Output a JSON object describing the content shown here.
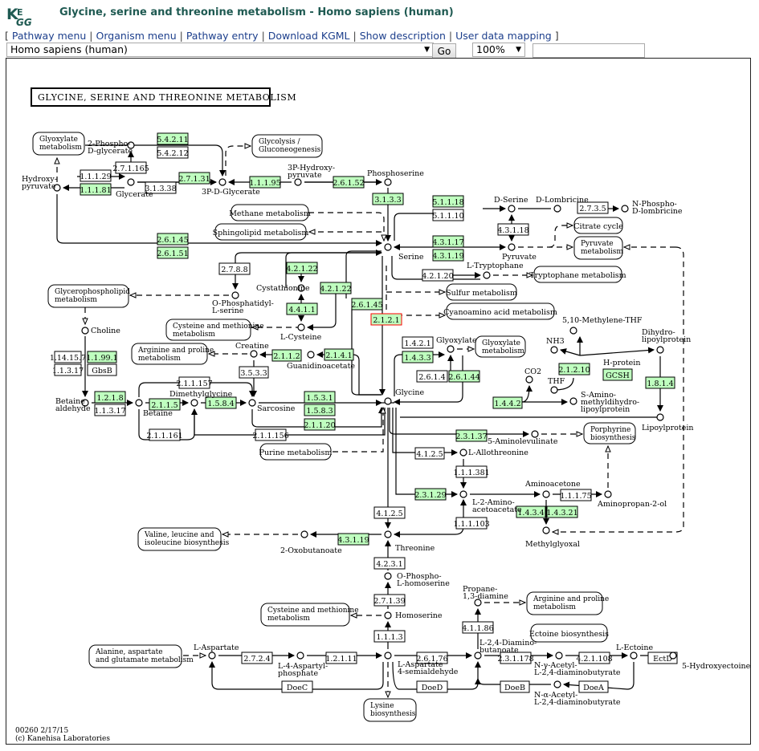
{
  "header": {
    "logo_text": "KEGG",
    "title": "Glycine, serine and threonine metabolism - Homo sapiens (human)"
  },
  "nav": {
    "open": "[",
    "close": "]",
    "sep": "|",
    "links": [
      "Pathway menu",
      "Organism menu",
      "Pathway entry",
      "Download KGML",
      "Show description",
      "User data mapping"
    ]
  },
  "controls": {
    "organism_selected": "Homo sapiens (human)",
    "go_label": "Go",
    "zoom_selected": "100%",
    "search_value": ""
  },
  "colors": {
    "link": "#1d3f8c",
    "title": "#1f5a52",
    "enzyme_present": "#bfffbf",
    "enzyme_highlight_border": "#ff0000"
  },
  "map": {
    "title": "GLYCINE, SERINE AND THREONINE METABOLISM",
    "footer_line1": "00260 2/17/15",
    "footer_line2": "(c) Kanehisa Laboratories",
    "pathways": [
      {
        "id": "p_glyox1",
        "lines": [
          "Glyoxylate",
          "metabolism"
        ]
      },
      {
        "id": "p_glycolysis",
        "lines": [
          "Glycolysis /",
          "Gluconeogenesis"
        ]
      },
      {
        "id": "p_methane",
        "lines": [
          "Methane metabolism"
        ]
      },
      {
        "id": "p_sphingo",
        "lines": [
          "Sphingolipid metabolism"
        ]
      },
      {
        "id": "p_citrate",
        "lines": [
          "Citrate cycle"
        ]
      },
      {
        "id": "p_pyruvate",
        "lines": [
          "Pyruvate",
          "metabolism"
        ]
      },
      {
        "id": "p_trp",
        "lines": [
          "Tryptophane metabolism"
        ]
      },
      {
        "id": "p_sulfur",
        "lines": [
          "Sulfur metabolism"
        ]
      },
      {
        "id": "p_cyano",
        "lines": [
          "Cyanoamino acid metabolism"
        ]
      },
      {
        "id": "p_glycerophos",
        "lines": [
          "Glycerophospholipid",
          "metabolism"
        ]
      },
      {
        "id": "p_cysmet1",
        "lines": [
          "Cysteine and methionine",
          "metabolism"
        ]
      },
      {
        "id": "p_argpro1",
        "lines": [
          "Arginine and proline",
          "metabolism"
        ]
      },
      {
        "id": "p_glyox2",
        "lines": [
          "Glyoxylate",
          "metabolism"
        ]
      },
      {
        "id": "p_purine",
        "lines": [
          "Purine metabolism"
        ]
      },
      {
        "id": "p_porph",
        "lines": [
          "Porphyrine",
          "biosynthesis"
        ]
      },
      {
        "id": "p_valleu",
        "lines": [
          "Valine, leucine and",
          "isoleucine biosynthesis"
        ]
      },
      {
        "id": "p_cysmet2",
        "lines": [
          "Cysteine and methionine",
          "metabolism"
        ]
      },
      {
        "id": "p_argpro2",
        "lines": [
          "Arginine and proline",
          "metabolism"
        ]
      },
      {
        "id": "p_ectoine",
        "lines": [
          "Ectoine biosynthesis"
        ]
      },
      {
        "id": "p_alaasp",
        "lines": [
          "Alanine, aspartate",
          "and glutamate metabolism"
        ]
      },
      {
        "id": "p_lysine",
        "lines": [
          "Lysine",
          "biosynthesis"
        ]
      }
    ],
    "enzymes": [
      {
        "id": "e1",
        "label": "5.4.2.11",
        "present": true
      },
      {
        "id": "e2",
        "label": "5.4.2.12",
        "present": false
      },
      {
        "id": "e3",
        "label": "2.7.1.165",
        "present": false
      },
      {
        "id": "e4",
        "label": "1.1.1.29",
        "present": false
      },
      {
        "id": "e5",
        "label": "1.1.1.81",
        "present": true
      },
      {
        "id": "e6",
        "label": "2.7.1.31",
        "present": true
      },
      {
        "id": "e7",
        "label": "3.1.3.38",
        "present": false
      },
      {
        "id": "e8",
        "label": "1.1.1.95",
        "present": true
      },
      {
        "id": "e9",
        "label": "2.6.1.52",
        "present": true
      },
      {
        "id": "e10",
        "label": "3.1.3.3",
        "present": true
      },
      {
        "id": "e11",
        "label": "5.1.1.18",
        "present": true
      },
      {
        "id": "e12",
        "label": "5.1.1.10",
        "present": false
      },
      {
        "id": "e13",
        "label": "2.7.3.5",
        "present": false
      },
      {
        "id": "e14",
        "label": "4.3.1.18",
        "present": false
      },
      {
        "id": "e15",
        "label": "2.6.1.45",
        "present": true
      },
      {
        "id": "e16",
        "label": "2.6.1.51",
        "present": true
      },
      {
        "id": "e17",
        "label": "4.3.1.17",
        "present": true
      },
      {
        "id": "e18",
        "label": "4.3.1.19",
        "present": true
      },
      {
        "id": "e19",
        "label": "2.7.8.8",
        "present": false
      },
      {
        "id": "e20",
        "label": "4.2.1.22",
        "present": true
      },
      {
        "id": "e21",
        "label": "4.2.1.22",
        "present": true
      },
      {
        "id": "e22",
        "label": "4.4.1.1",
        "present": true
      },
      {
        "id": "e23",
        "label": "4.2.1.20",
        "present": false
      },
      {
        "id": "e24",
        "label": "2.6.1.45",
        "present": true
      },
      {
        "id": "e25",
        "label": "2.1.2.1",
        "present": true,
        "highlight": true
      },
      {
        "id": "e26",
        "label": "1.14.15.7",
        "present": false
      },
      {
        "id": "e27",
        "label": "1.1.99.1",
        "present": true
      },
      {
        "id": "e28",
        "label": "1.1.3.17",
        "present": false
      },
      {
        "id": "e29",
        "label": "GbsB",
        "present": false
      },
      {
        "id": "e30",
        "label": "2.1.1.2",
        "present": true
      },
      {
        "id": "e31",
        "label": "2.1.4.1",
        "present": true
      },
      {
        "id": "e32",
        "label": "3.5.3.3",
        "present": false
      },
      {
        "id": "e33",
        "label": "1.4.2.1",
        "present": false
      },
      {
        "id": "e34",
        "label": "1.4.3.3",
        "present": true
      },
      {
        "id": "e35",
        "label": "2.6.1.4",
        "present": false
      },
      {
        "id": "e36",
        "label": "2.6.1.44",
        "present": true
      },
      {
        "id": "e37",
        "label": "2.1.2.10",
        "present": true
      },
      {
        "id": "e38",
        "label": "GCSH",
        "present": true
      },
      {
        "id": "e39",
        "label": "1.8.1.4",
        "present": true
      },
      {
        "id": "e40",
        "label": "1.4.4.2",
        "present": true
      },
      {
        "id": "e41",
        "label": "2.1.1.157",
        "present": false
      },
      {
        "id": "e42",
        "label": "1.2.1.8",
        "present": true
      },
      {
        "id": "e43",
        "label": "1.1.3.17",
        "present": false
      },
      {
        "id": "e44",
        "label": "2.1.1.5",
        "present": true
      },
      {
        "id": "e45",
        "label": "1.5.8.4",
        "present": true
      },
      {
        "id": "e46",
        "label": "1.5.3.1",
        "present": true
      },
      {
        "id": "e47",
        "label": "1.5.8.3",
        "present": true
      },
      {
        "id": "e48",
        "label": "2.1.1.20",
        "present": true
      },
      {
        "id": "e49",
        "label": "2.1.1.161",
        "present": false
      },
      {
        "id": "e50",
        "label": "2.1.1.156",
        "present": false
      },
      {
        "id": "e51",
        "label": "2.3.1.37",
        "present": true
      },
      {
        "id": "e52",
        "label": "4.1.2.5",
        "present": false
      },
      {
        "id": "e53",
        "label": "1.1.1.381",
        "present": false
      },
      {
        "id": "e54",
        "label": "2.3.1.29",
        "present": true
      },
      {
        "id": "e55",
        "label": "1.1.1.75",
        "present": false
      },
      {
        "id": "e56",
        "label": "1.4.3.4",
        "present": true
      },
      {
        "id": "e57",
        "label": "1.4.3.21",
        "present": true
      },
      {
        "id": "e58",
        "label": "4.1.2.5",
        "present": false
      },
      {
        "id": "e59",
        "label": "1.1.1.103",
        "present": false
      },
      {
        "id": "e60",
        "label": "4.3.1.19",
        "present": true
      },
      {
        "id": "e61",
        "label": "4.2.3.1",
        "present": false
      },
      {
        "id": "e62",
        "label": "2.7.1.39",
        "present": false
      },
      {
        "id": "e63",
        "label": "1.1.1.3",
        "present": false
      },
      {
        "id": "e64",
        "label": "4.1.1.86",
        "present": false
      },
      {
        "id": "e65",
        "label": "2.7.2.4",
        "present": false
      },
      {
        "id": "e66",
        "label": "1.2.1.11",
        "present": false
      },
      {
        "id": "e67",
        "label": "2.6.1.76",
        "present": false
      },
      {
        "id": "e68",
        "label": "2.3.1.178",
        "present": false
      },
      {
        "id": "e69",
        "label": "4.2.1.108",
        "present": false
      },
      {
        "id": "e70",
        "label": "EctD",
        "present": false
      },
      {
        "id": "e71",
        "label": "DoeC",
        "present": false
      },
      {
        "id": "e72",
        "label": "DoeD",
        "present": false
      },
      {
        "id": "e73",
        "label": "DoeB",
        "present": false
      },
      {
        "id": "e74",
        "label": "DoeA",
        "present": false
      }
    ],
    "compounds": [
      {
        "id": "c_2pg",
        "lines": [
          "2-Phospho-",
          "D-glycerate"
        ]
      },
      {
        "id": "c_hp",
        "lines": [
          "Hydroxy-",
          "pyruvate"
        ]
      },
      {
        "id": "c_glycerate",
        "lines": [
          "Glycerate"
        ]
      },
      {
        "id": "c_3pg",
        "lines": [
          "3P-D-Glycerate"
        ]
      },
      {
        "id": "c_3php",
        "lines": [
          "3P-Hydroxy-",
          "pyruvate"
        ]
      },
      {
        "id": "c_phser",
        "lines": [
          "Phosphoserine"
        ]
      },
      {
        "id": "c_dser",
        "lines": [
          "D-Serine"
        ]
      },
      {
        "id": "c_dlomb",
        "lines": [
          "D-Lombricine"
        ]
      },
      {
        "id": "c_nphlomb",
        "lines": [
          "N-Phospho-",
          "D-lombricine"
        ]
      },
      {
        "id": "c_pyruvate",
        "lines": [
          "Pyruvate"
        ]
      },
      {
        "id": "c_serine",
        "lines": [
          "Serine"
        ]
      },
      {
        "id": "c_trp",
        "lines": [
          "L-Tryptophane"
        ]
      },
      {
        "id": "c_cysta",
        "lines": [
          "Cystathionine"
        ]
      },
      {
        "id": "c_ops",
        "lines": [
          "O-Phosphatidyl-",
          "L-serine"
        ]
      },
      {
        "id": "c_cys",
        "lines": [
          "L-Cysteine"
        ]
      },
      {
        "id": "c_choline",
        "lines": [
          "Choline"
        ]
      },
      {
        "id": "c_creatine",
        "lines": [
          "Creatine"
        ]
      },
      {
        "id": "c_guan",
        "lines": [
          "Guanidinoacetate"
        ]
      },
      {
        "id": "c_glyox",
        "lines": [
          "Glyoxylate"
        ]
      },
      {
        "id": "c_mthf",
        "lines": [
          "5,10-Methylene-THF"
        ]
      },
      {
        "id": "c_nh3",
        "lines": [
          "NH3"
        ]
      },
      {
        "id": "c_dhlp",
        "lines": [
          "Dihydro-",
          "lipoylprotein"
        ]
      },
      {
        "id": "c_hprot",
        "lines": [
          "H-protein"
        ]
      },
      {
        "id": "c_co2",
        "lines": [
          "CO2"
        ]
      },
      {
        "id": "c_thf",
        "lines": [
          "THF"
        ]
      },
      {
        "id": "c_samdlp",
        "lines": [
          "S-Amino-",
          "methyldihydro-",
          "lipoylprotein"
        ]
      },
      {
        "id": "c_lipoyl",
        "lines": [
          "Lipoylprotein"
        ]
      },
      {
        "id": "c_glycine",
        "lines": [
          "Glycine"
        ]
      },
      {
        "id": "c_betald",
        "lines": [
          "Betaine",
          "aldehyde"
        ]
      },
      {
        "id": "c_betaine",
        "lines": [
          "Betaine"
        ]
      },
      {
        "id": "c_dmg",
        "lines": [
          "Dimethylglycine"
        ]
      },
      {
        "id": "c_sarc",
        "lines": [
          "Sarcosine"
        ]
      },
      {
        "id": "c_ala",
        "lines": [
          "5-Aminolevulinate"
        ]
      },
      {
        "id": "c_allothr",
        "lines": [
          "L-Allothreonine"
        ]
      },
      {
        "id": "c_amac",
        "lines": [
          "Aminoacetone"
        ]
      },
      {
        "id": "c_l2aa",
        "lines": [
          "L-2-Amino-",
          "acetoacetate"
        ]
      },
      {
        "id": "c_amprop",
        "lines": [
          "Aminopropan-2-ol"
        ]
      },
      {
        "id": "c_mg",
        "lines": [
          "Methylglyoxal"
        ]
      },
      {
        "id": "c_oxob",
        "lines": [
          "2-Oxobutanoate"
        ]
      },
      {
        "id": "c_thr",
        "lines": [
          "Threonine"
        ]
      },
      {
        "id": "c_ophs",
        "lines": [
          "O-Phospho-",
          "L-homoserine"
        ]
      },
      {
        "id": "c_hser",
        "lines": [
          "Homoserine"
        ]
      },
      {
        "id": "c_propd",
        "lines": [
          "Propane-",
          "1,3-diamine"
        ]
      },
      {
        "id": "c_laspp",
        "lines": [
          "L-Aspartate"
        ]
      },
      {
        "id": "c_l4ap",
        "lines": [
          "L-4-Aspartyl-",
          "phosphate"
        ]
      },
      {
        "id": "c_lasa",
        "lines": [
          "L-Aspartate",
          "4-semialdehyde"
        ]
      },
      {
        "id": "c_dab",
        "lines": [
          "L-2,4-Diamino-",
          "butanoate"
        ]
      },
      {
        "id": "c_ngamma",
        "lines": [
          "N-γ-Acetyl-",
          "L-2,4-diaminobutyrate"
        ]
      },
      {
        "id": "c_nalpha",
        "lines": [
          "N-α-Acetyl-",
          "L-2,4-diaminobutyrate"
        ]
      },
      {
        "id": "c_ectoine",
        "lines": [
          "L-Ectoine"
        ]
      },
      {
        "id": "c_5hect",
        "lines": [
          "5-Hydroxyectoine"
        ]
      }
    ]
  }
}
